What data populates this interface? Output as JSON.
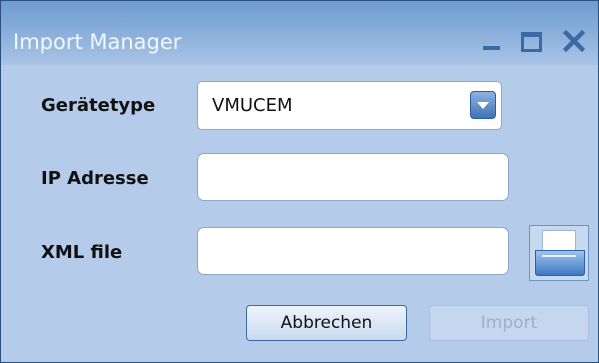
{
  "window": {
    "title": "Import Manager",
    "controls": [
      "minimize-icon",
      "maximize-icon",
      "close-icon"
    ]
  },
  "form": {
    "device_type": {
      "label": "Gerätetype",
      "value": "VMUCEM"
    },
    "ip_address": {
      "label": "IP Adresse",
      "value": ""
    },
    "xml_file": {
      "label": "XML file",
      "value": ""
    }
  },
  "buttons": {
    "cancel_label": "Abbrechen",
    "import_label": "Import"
  },
  "colors": {
    "window_bg": "#b4cbe9",
    "title_bar": "#87add9",
    "accent": "#3a6aa6"
  }
}
